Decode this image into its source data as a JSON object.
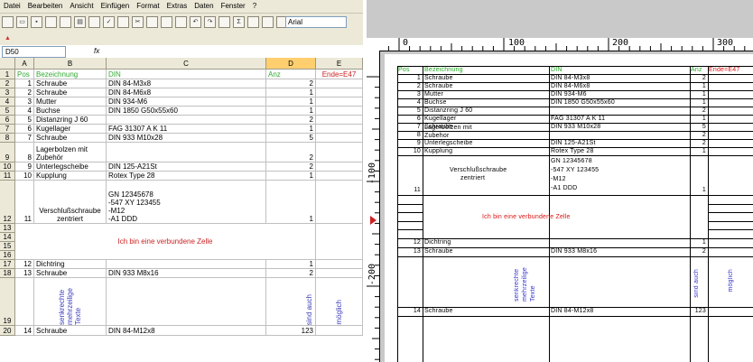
{
  "spreadsheet": {
    "menu": [
      "Datei",
      "Bearbeiten",
      "Ansicht",
      "Einfügen",
      "Format",
      "Extras",
      "Daten",
      "Fenster",
      "?"
    ],
    "toolbar": {
      "sum_symbol": "Σ",
      "font_name": "Arial"
    },
    "name_box": "D50",
    "fx_label": "fx",
    "columns": [
      "A",
      "B",
      "C",
      "D",
      "E"
    ],
    "rows": [
      {
        "n": "1",
        "a": "Pos",
        "b": "Bezeichnung",
        "c": "DIN",
        "d": "Anz",
        "e": "Ende=E47"
      },
      {
        "n": "2",
        "a": "1",
        "b": "Schraube",
        "c": "DIN 84-M3x8",
        "d": "2",
        "e": ""
      },
      {
        "n": "3",
        "a": "2",
        "b": "Schraube",
        "c": "DIN 84-M6x8",
        "d": "1",
        "e": ""
      },
      {
        "n": "4",
        "a": "3",
        "b": "Mutter",
        "c": "DIN 934-M6",
        "d": "1",
        "e": ""
      },
      {
        "n": "5",
        "a": "4",
        "b": "Buchse",
        "c": "DIN 1850 G50x55x60",
        "d": "1",
        "e": ""
      },
      {
        "n": "6",
        "a": "5",
        "b": "Distanzring J 60",
        "c": "",
        "d": "2",
        "e": ""
      },
      {
        "n": "7",
        "a": "6",
        "b": "Kugellager",
        "c": "FAG 31307 A K 11",
        "d": "1",
        "e": ""
      },
      {
        "n": "8",
        "a": "7",
        "b": "Schraube",
        "c": "DIN 933 M10x28",
        "d": "5",
        "e": ""
      },
      {
        "n": "9",
        "a": "8",
        "b": "Lagerbolzen mit Zubehör",
        "c": "",
        "d": "2",
        "e": ""
      },
      {
        "n": "10",
        "a": "9",
        "b": "Unterlegscheibe",
        "c": "DIN 125-A21St",
        "d": "2",
        "e": ""
      },
      {
        "n": "11",
        "a": "10",
        "b": "Kupplung",
        "c": "Rotex Type 28",
        "d": "1",
        "e": ""
      },
      {
        "n": "12",
        "a": "11",
        "b": "Verschlußschraube zentriert",
        "c": "GN 12345678\n-547 XY 123455\n-M12\n-A1 DDD",
        "d": "1",
        "e": ""
      },
      {
        "n": "13",
        "a": "",
        "b": "",
        "c": "",
        "d": "",
        "e": ""
      },
      {
        "n": "14",
        "a": "",
        "b": "",
        "c": "",
        "d": "",
        "e": ""
      },
      {
        "n": "15",
        "a": "",
        "b": "",
        "c": "",
        "d": "",
        "e": ""
      },
      {
        "n": "16",
        "a": "",
        "b": "",
        "c": "",
        "d": "",
        "e": ""
      },
      {
        "n": "17",
        "a": "12",
        "b": "Dichtring",
        "c": "",
        "d": "1",
        "e": ""
      },
      {
        "n": "18",
        "a": "13",
        "b": "Schraube",
        "c": "DIN 933 M8x16",
        "d": "2",
        "e": ""
      },
      {
        "n": "19",
        "a": "",
        "b": "senkrechte mehrzeilige Texte",
        "c": "",
        "d": "sind auch",
        "e": "möglich"
      },
      {
        "n": "20",
        "a": "14",
        "b": "Schraube",
        "c": "DIN 84-M12x8",
        "d": "123",
        "e": ""
      }
    ],
    "merged_text": "Ich bin eine verbundene Zelle"
  },
  "cad": {
    "ruler_top": [
      "0",
      "100",
      "200",
      "300"
    ],
    "ruler_left": [
      "-100",
      "-200"
    ],
    "corner_symbol": "+",
    "headers": {
      "pos": "Pos",
      "bez": "Bezeichnung",
      "din": "DIN",
      "anz": "Anz",
      "ende": "Ende=E47"
    },
    "rows": [
      {
        "a": "1",
        "b": "Schraube",
        "c": "DIN 84-M3x8",
        "d": "2"
      },
      {
        "a": "2",
        "b": "Schraube",
        "c": "DIN 84-M6x8",
        "d": "1"
      },
      {
        "a": "3",
        "b": "Mutter",
        "c": "DIN 934-M6",
        "d": "1"
      },
      {
        "a": "4",
        "b": "Buchse",
        "c": "DIN 1850 G50x55x60",
        "d": "1"
      },
      {
        "a": "5",
        "b": "Distanzring J 60",
        "c": "",
        "d": "2"
      },
      {
        "a": "6",
        "b": "Kugellager",
        "c": "FAG 31307 A K 11",
        "d": "1"
      },
      {
        "a": "7",
        "b": "Schraube",
        "c": "DIN 933 M10x28",
        "d": "5"
      },
      {
        "a": "8",
        "b": "Lagerbolzen mit Zubehor",
        "c": "",
        "d": "2"
      },
      {
        "a": "9",
        "b": "Unterlegscheibe",
        "c": "DIN 125-A21St",
        "d": "2"
      },
      {
        "a": "10",
        "b": "Kupplung",
        "c": "Rotex Type 28",
        "d": "1"
      }
    ],
    "row11": {
      "a": "11",
      "b1": "Verschlußschraube",
      "b2": "zentriert",
      "c": [
        "GN 12345678",
        "-547 XY 123455",
        "-M12",
        "-A1 DDD"
      ],
      "d": "1"
    },
    "merged_text": "Ich bin eine verbundene Zelle",
    "row12": {
      "a": "12",
      "b": "Dichtring",
      "d": "1"
    },
    "row13": {
      "a": "13",
      "b": "Schraube",
      "c": "DIN 933 M8x16",
      "d": "2"
    },
    "vert_b": "senkrechte mehrzeilige Texte",
    "vert_d": "sind auch",
    "vert_e": "möglich",
    "row14": {
      "a": "14",
      "b": "Schraube",
      "c": "DIN 84-M12x8",
      "d": "123"
    }
  }
}
